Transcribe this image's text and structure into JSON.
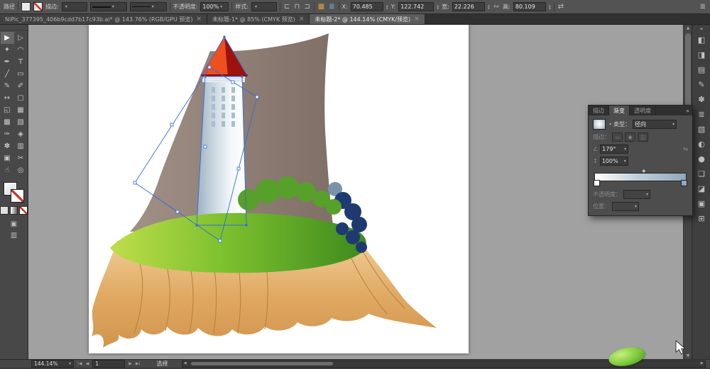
{
  "icons": {
    "dropdown": "▾",
    "close": "×",
    "collapse": "»",
    "expand": "«",
    "menu": "≣",
    "reverse": "⇆",
    "angle": "∠",
    "aspect": "↕",
    "link": "∾",
    "up": "▲",
    "down": "▼",
    "left_arrow": "◀",
    "right_arrow": "▶",
    "first": "|◀",
    "last": "▶|"
  },
  "control_bar": {
    "object_label": "路径",
    "stroke_label": "描边:",
    "opacity_label": "不透明度:",
    "opacity_value": "100%",
    "style_label": "样式:",
    "align_icons": {
      "a1": "⊏",
      "a2": "⊓",
      "a3": "⊐"
    },
    "grid_icon": "▦",
    "stack_icon": "≣",
    "swap_icon": "⇄",
    "transform_fields": [
      {
        "label": "X:",
        "value": "70.485"
      },
      {
        "label": "Y:",
        "value": "122.742"
      },
      {
        "label": "宽:",
        "value": "22.226"
      },
      {
        "label": "高:",
        "value": "80.109"
      }
    ]
  },
  "tabs": [
    {
      "label": "NiPic_377395_406b9cdd7b17c93b.ai* @ 143.76% (RGB/GPU 预览)",
      "active": false
    },
    {
      "label": "未标题-1* @ 85% (CMYK 预览)",
      "active": false
    },
    {
      "label": "未标题-2* @ 144.14% (CMYK/预览)",
      "active": true
    }
  ],
  "toolbar": {
    "tools": [
      {
        "name": "selection-tool",
        "glyph": "▶",
        "active": true
      },
      {
        "name": "direct-selection-tool",
        "glyph": "▷"
      },
      {
        "name": "magic-wand-tool",
        "glyph": "✦"
      },
      {
        "name": "lasso-tool",
        "glyph": "◠"
      },
      {
        "name": "pen-tool",
        "glyph": "✒"
      },
      {
        "name": "type-tool",
        "glyph": "T"
      },
      {
        "name": "line-segment-tool",
        "glyph": "╱"
      },
      {
        "name": "rectangle-tool",
        "glyph": "▭"
      },
      {
        "name": "paintbrush-tool",
        "glyph": "✎"
      },
      {
        "name": "pencil-tool",
        "glyph": "✐"
      },
      {
        "name": "width-tool",
        "glyph": "↔"
      },
      {
        "name": "free-transform-tool",
        "glyph": "▢"
      },
      {
        "name": "shape-builder-tool",
        "glyph": "◱"
      },
      {
        "name": "perspective-grid-tool",
        "glyph": "▦"
      },
      {
        "name": "mesh-tool",
        "glyph": "▩"
      },
      {
        "name": "gradient-tool",
        "glyph": "▧"
      },
      {
        "name": "eyedropper-tool",
        "glyph": "✑"
      },
      {
        "name": "blend-tool",
        "glyph": "◈"
      },
      {
        "name": "symbol-sprayer-tool",
        "glyph": "✽"
      },
      {
        "name": "column-graph-tool",
        "glyph": "▥"
      },
      {
        "name": "artboard-tool",
        "glyph": "▣"
      },
      {
        "name": "slice-tool",
        "glyph": "✂"
      },
      {
        "name": "hand-tool",
        "glyph": "☝"
      },
      {
        "name": "zoom-tool",
        "glyph": "◎"
      }
    ]
  },
  "dock": {
    "icons": [
      {
        "name": "color-panel-icon",
        "glyph": "◧"
      },
      {
        "name": "color-guide-panel-icon",
        "glyph": "◨"
      },
      {
        "name": "swatches-panel-icon",
        "glyph": "▤"
      },
      {
        "name": "brushes-panel-icon",
        "glyph": "✎"
      },
      {
        "name": "symbols-panel-icon",
        "glyph": "✽"
      },
      {
        "name": "stroke-panel-icon",
        "glyph": "≣"
      },
      {
        "name": "gradient-panel-icon",
        "glyph": "▧"
      },
      {
        "name": "transparency-panel-icon",
        "glyph": "◐"
      },
      {
        "name": "appearance-panel-icon",
        "glyph": "●"
      },
      {
        "name": "graphic-styles-panel-icon",
        "glyph": "❏"
      },
      {
        "name": "layers-panel-icon",
        "glyph": "◪"
      },
      {
        "name": "artboards-panel-icon",
        "glyph": "▣"
      },
      {
        "name": "align-panel-icon",
        "glyph": "⊞"
      }
    ]
  },
  "gradient_panel": {
    "tab_stroke": "描边",
    "tab_gradient": "渐变",
    "tab_transparency": "透明度",
    "type_label": "类型：",
    "type_value": "径向",
    "stroke_row_label": "描边：",
    "stroke_icons": {
      "i1": "▭",
      "i2": "◉",
      "i3": "◫"
    },
    "angle_value": "179°",
    "aspect_value": "100%",
    "opacity_label": "不透明度：",
    "location_label": "位置："
  },
  "status_bar": {
    "zoom_value": "144.14%",
    "artboard_nav_value": "1",
    "tool_status": "选择"
  },
  "artwork_colors": {
    "mountain": "#8f7f75",
    "roof_light": "#ee4f1f",
    "roof_dark": "#9e120d",
    "tower_shade": "#9db1c0",
    "grass_light": "#c0dd4a",
    "grass_dark": "#3e8a1e",
    "bush_green": "#57a02a",
    "bush_navy": "#1f3a70",
    "cliff_tan": "#e0aa63",
    "selection_blue": "#2e6be2"
  }
}
